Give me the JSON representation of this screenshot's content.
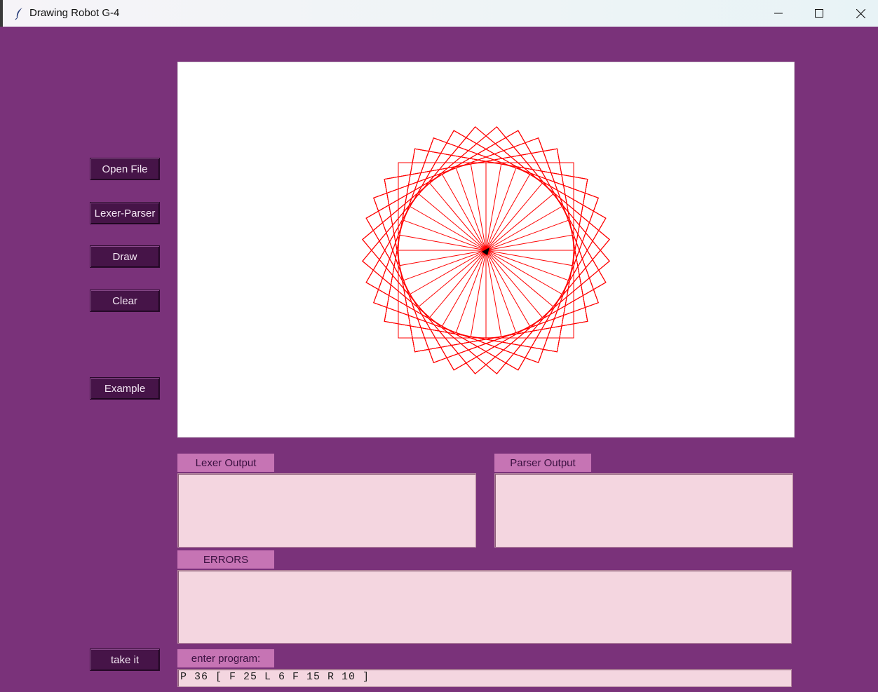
{
  "window": {
    "title": "Drawing Robot G-4",
    "controls": [
      "minimize",
      "maximize",
      "close"
    ]
  },
  "sidebar": {
    "open_file": "Open File",
    "lexer_parser": "Lexer-Parser",
    "draw": "Draw",
    "clear": "Clear",
    "example": "Example",
    "take_it": "take it"
  },
  "canvas": {
    "stroke_color": "#ff0000",
    "turtle_color": "#000000",
    "program_result": {
      "polygon_sides": 4,
      "side": 25,
      "inner_lines": 36,
      "repeat": 36,
      "turn_deg": 10
    }
  },
  "panels": {
    "lexer_label": "Lexer Output",
    "lexer_text": "",
    "parser_label": "Parser Output",
    "parser_text": "",
    "errors_label": "ERRORS",
    "errors_text": "",
    "program_label": "enter program:"
  },
  "program": {
    "value": "P 36 [ F 25 L 6 F 15 R 10 ]"
  },
  "colors": {
    "background": "#7a327a",
    "button": "#461448",
    "label": "#c674b4",
    "textbox": "#f4d6e0"
  }
}
